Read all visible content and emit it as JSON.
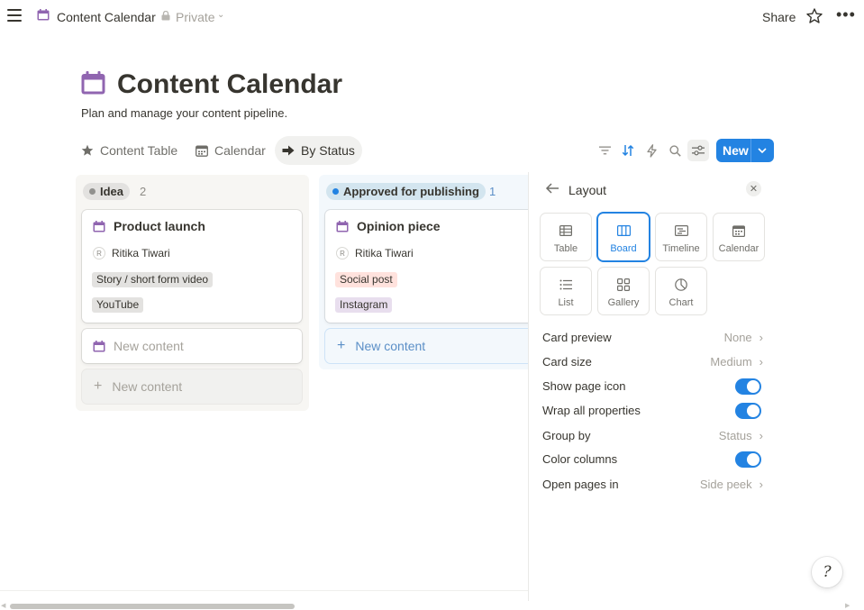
{
  "topbar": {
    "title": "Content Calendar",
    "privacy": "Private",
    "share_label": "Share",
    "more_label": "•••"
  },
  "page": {
    "title": "Content Calendar",
    "description": "Plan and manage your content pipeline."
  },
  "views": {
    "tabs": [
      {
        "label": "Content Table",
        "icon": "star-icon"
      },
      {
        "label": "Calendar",
        "icon": "calendar-view-icon"
      },
      {
        "label": "By Status",
        "icon": "arrow-right-icon",
        "active": true
      }
    ],
    "new_label": "New"
  },
  "board": {
    "columns": [
      {
        "name": "Idea",
        "count": "2",
        "dot_color": "#91918e",
        "pill_bg": "#e3e2e0",
        "cards": [
          {
            "title": "Product launch",
            "person": "Ritika Tiwari",
            "avatar": "R",
            "tags": [
              {
                "label": "Story / short form video",
                "bg": "#e3e2e0"
              },
              {
                "label": "YouTube",
                "bg": "#e3e2e0"
              }
            ]
          }
        ],
        "new_card_label": "New content",
        "new_button_label": "New content"
      },
      {
        "name": "Approved for publishing",
        "count": "1",
        "dot_color": "#2383e2",
        "pill_bg": "#d3e5ef",
        "cards": [
          {
            "title": "Opinion piece",
            "person": "Ritika Tiwari",
            "avatar": "R",
            "tags": [
              {
                "label": "Social post",
                "bg": "#ffe2dd"
              },
              {
                "label": "Instagram",
                "bg": "#e8deee"
              }
            ]
          }
        ],
        "new_button_label": "New content"
      }
    ]
  },
  "panel": {
    "title": "Layout",
    "layouts": [
      {
        "label": "Table",
        "icon": "table-layout-icon"
      },
      {
        "label": "Board",
        "icon": "board-layout-icon",
        "selected": true
      },
      {
        "label": "Timeline",
        "icon": "timeline-layout-icon"
      },
      {
        "label": "Calendar",
        "icon": "calendar-layout-icon"
      },
      {
        "label": "List",
        "icon": "list-layout-icon"
      },
      {
        "label": "Gallery",
        "icon": "gallery-layout-icon"
      },
      {
        "label": "Chart",
        "icon": "chart-layout-icon"
      }
    ],
    "settings": [
      {
        "label": "Card preview",
        "value": "None",
        "type": "select"
      },
      {
        "label": "Card size",
        "value": "Medium",
        "type": "select"
      },
      {
        "label": "Show page icon",
        "type": "toggle",
        "on": true
      },
      {
        "label": "Wrap all properties",
        "type": "toggle",
        "on": true
      },
      {
        "label": "Group by",
        "value": "Status",
        "type": "select"
      },
      {
        "label": "Color columns",
        "type": "toggle",
        "on": true
      },
      {
        "label": "Open pages in",
        "value": "Side peek",
        "type": "select"
      }
    ]
  },
  "colors": {
    "accent": "#2383e2",
    "calendar_icon": "#9b59b6",
    "text": "#37352f",
    "muted": "#a5a29b"
  },
  "help_label": "?"
}
